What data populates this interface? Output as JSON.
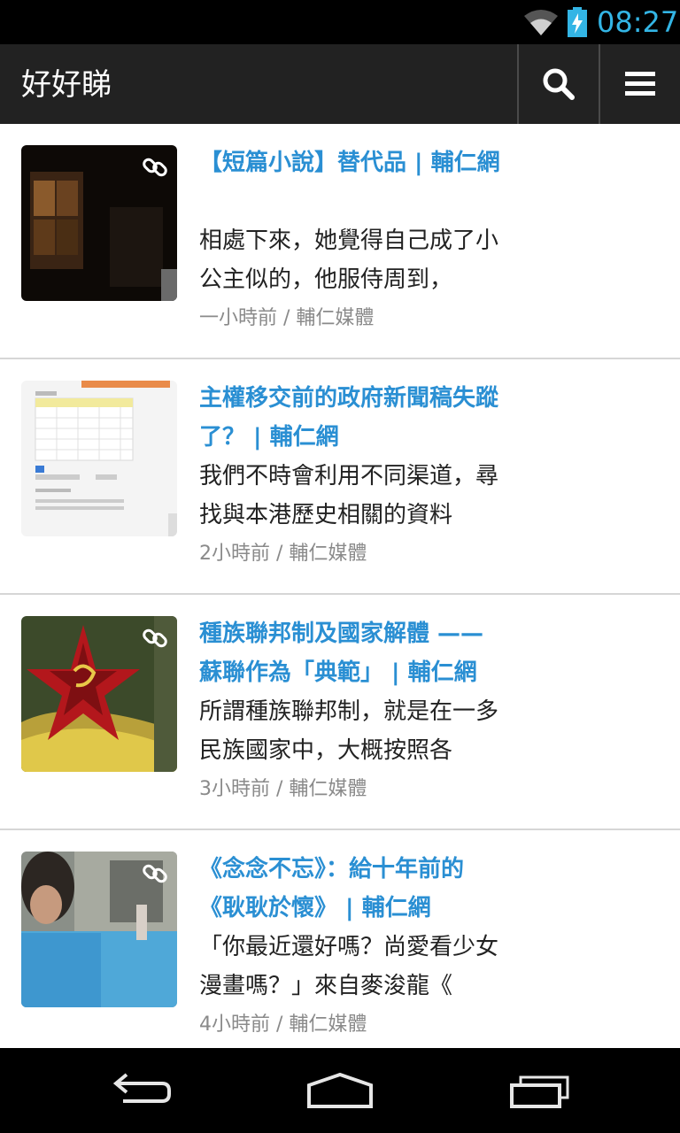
{
  "status_bar": {
    "time": "08:27",
    "accent": "#33b5e5"
  },
  "action_bar": {
    "title": "好好睇",
    "search_icon": "search-icon",
    "menu_icon": "hamburger-menu-icon"
  },
  "articles": [
    {
      "title": "【短篇小說】替代品 | 輔仁網",
      "snippet": "相處下來，她覺得自己成了小公主似的，他服侍周到，",
      "time": "一小時前",
      "source": "輔仁媒體",
      "meta": "一小時前 / 輔仁媒體",
      "has_link_icon": true
    },
    {
      "title": "主權移交前的政府新聞稿失蹤了？ | 輔仁網",
      "snippet": "我們不時會利用不同渠道，尋找與本港歷史相關的資料",
      "time": "2小時前",
      "source": "輔仁媒體",
      "meta": "2小時前 / 輔仁媒體",
      "has_link_icon": false
    },
    {
      "title": "種族聯邦制及國家解體 ——蘇聯作為「典範」 | 輔仁網",
      "snippet": "所謂種族聯邦制，就是在一多民族國家中，大概按照各",
      "time": "3小時前",
      "source": "輔仁媒體",
      "meta": "3小時前 / 輔仁媒體",
      "has_link_icon": true
    },
    {
      "title": "《念念不忘》：給十年前的《耿耿於懷》 | 輔仁網",
      "snippet": "「你最近還好嗎？尚愛看少女漫畫嗎？」來自麥浚龍《",
      "time": "4小時前",
      "source": "輔仁媒體",
      "meta": "4小時前 / 輔仁媒體",
      "has_link_icon": true
    }
  ],
  "nav_bar": {
    "back_icon": "back-icon",
    "home_icon": "home-icon",
    "recents_icon": "recent-apps-icon"
  },
  "colors": {
    "headline": "#2a8fd3",
    "action_bar": "#222222"
  }
}
